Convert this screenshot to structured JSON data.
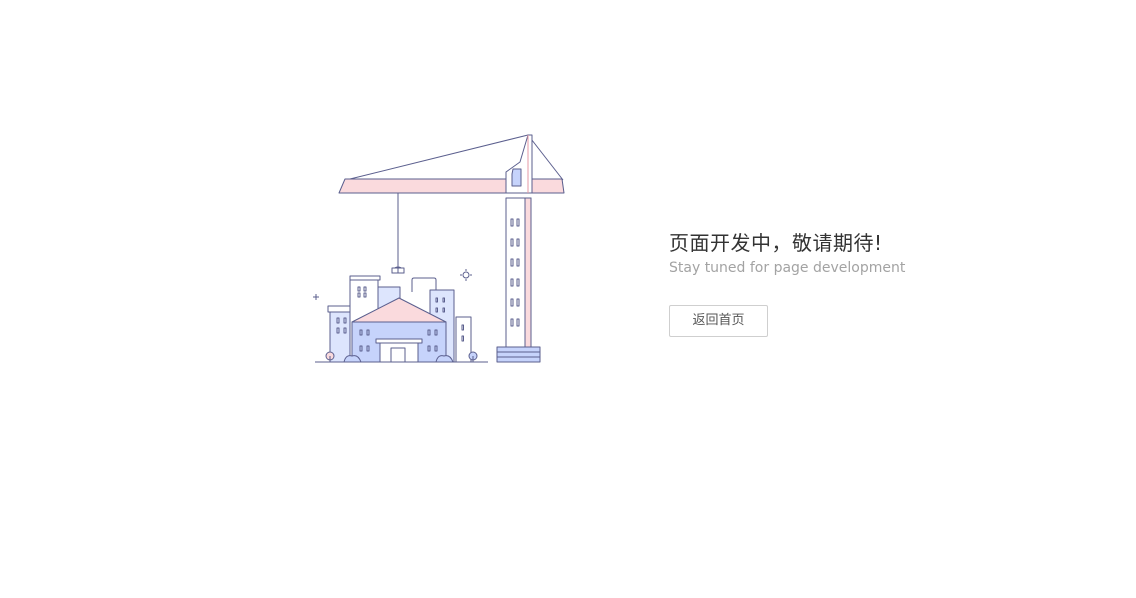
{
  "message": {
    "title": "页面开发中，敬请期待!",
    "subtitle": "Stay tuned for page development"
  },
  "actions": {
    "home_label": "返回首页"
  },
  "illustration": {
    "icon": "construction-crane-illustration",
    "colors": {
      "stroke": "#5b5f8e",
      "pink": "#fadadd",
      "blue": "#c6d3fb",
      "light_blue": "#dde5fd"
    }
  }
}
